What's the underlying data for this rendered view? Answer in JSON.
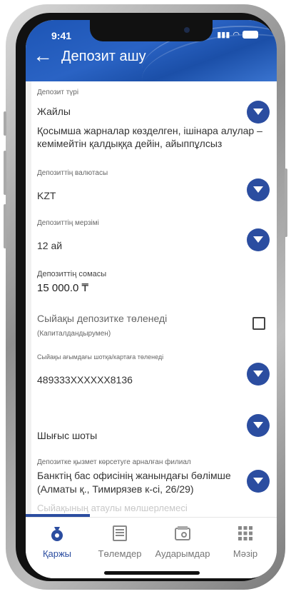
{
  "status_bar": {
    "time": "9:41"
  },
  "header": {
    "title": "Депозит ашу"
  },
  "fields": {
    "deposit_type": {
      "label": "Депозит түрі",
      "value": "Жайлы",
      "description": "Қосымша жарналар көзделген, ішінара алулар – кемімейтін қалдыққа дейін, айыппұлсыз"
    },
    "currency": {
      "label": "Депозиттің валютасы",
      "value": "KZT"
    },
    "term": {
      "label": "Депозиттің мерзімі",
      "value": "12 ай"
    },
    "amount": {
      "label": "Депозиттің сомасы",
      "value": "15 000.0 ₸"
    },
    "reward": {
      "label": "Сыйақы депозитке төленеді",
      "sublabel": "(Капиталдандырумен)",
      "checked": false
    },
    "payout_account": {
      "label": "Сыйақы ағымдағы шотқа/картаға төленеді",
      "value": "489333XXXXXX8136"
    },
    "expense_account": {
      "value": "Шығыс шоты"
    },
    "branch": {
      "label": "Депозитке қызмет көрсетуге арналған филиал",
      "value_line1": "Банктің бас офисінің жанындағы бөлімше",
      "value_line2": "(Алматы қ., Тимирязев к-сі, 26/29)"
    },
    "faded_field": {
      "label": "Сыйақының атаулы мөлшерлемесі"
    }
  },
  "tabs": [
    {
      "label": "Қаржы",
      "icon": "money-bag-icon",
      "active": true
    },
    {
      "label": "Төлемдер",
      "icon": "payments-icon",
      "active": false
    },
    {
      "label": "Аударымдар",
      "icon": "wallet-transfer-icon",
      "active": false
    },
    {
      "label": "Мәзір",
      "icon": "menu-grid-icon",
      "active": false
    }
  ],
  "colors": {
    "accent": "#2b4da0",
    "header": "#1d55b5"
  }
}
